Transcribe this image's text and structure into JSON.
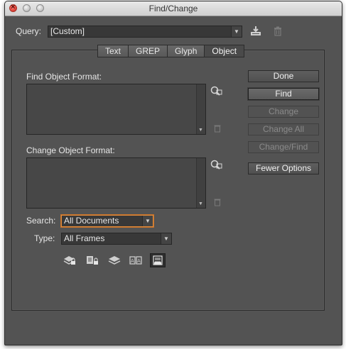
{
  "window": {
    "title": "Find/Change"
  },
  "query": {
    "label": "Query:",
    "value": "[Custom]"
  },
  "tabs": [
    {
      "label": "Text"
    },
    {
      "label": "GREP"
    },
    {
      "label": "Glyph"
    },
    {
      "label": "Object"
    }
  ],
  "find_section": {
    "label": "Find Object Format:"
  },
  "change_section": {
    "label": "Change Object Format:"
  },
  "buttons": {
    "done": "Done",
    "find": "Find",
    "change": "Change",
    "change_all": "Change All",
    "change_find": "Change/Find",
    "fewer_options": "Fewer Options"
  },
  "search": {
    "label": "Search:",
    "value": "All Documents"
  },
  "type": {
    "label": "Type:",
    "value": "All Frames"
  },
  "icons": {
    "save_query": "save-query-icon",
    "delete_query": "trash-icon",
    "specify_format": "specify-format-icon",
    "options": [
      "locked-layers-icon",
      "locked-items-icon",
      "hidden-layers-icon",
      "master-pages-icon",
      "footnotes-icon"
    ]
  },
  "colors": {
    "accent": "#e08b3c",
    "panel": "#535353"
  }
}
